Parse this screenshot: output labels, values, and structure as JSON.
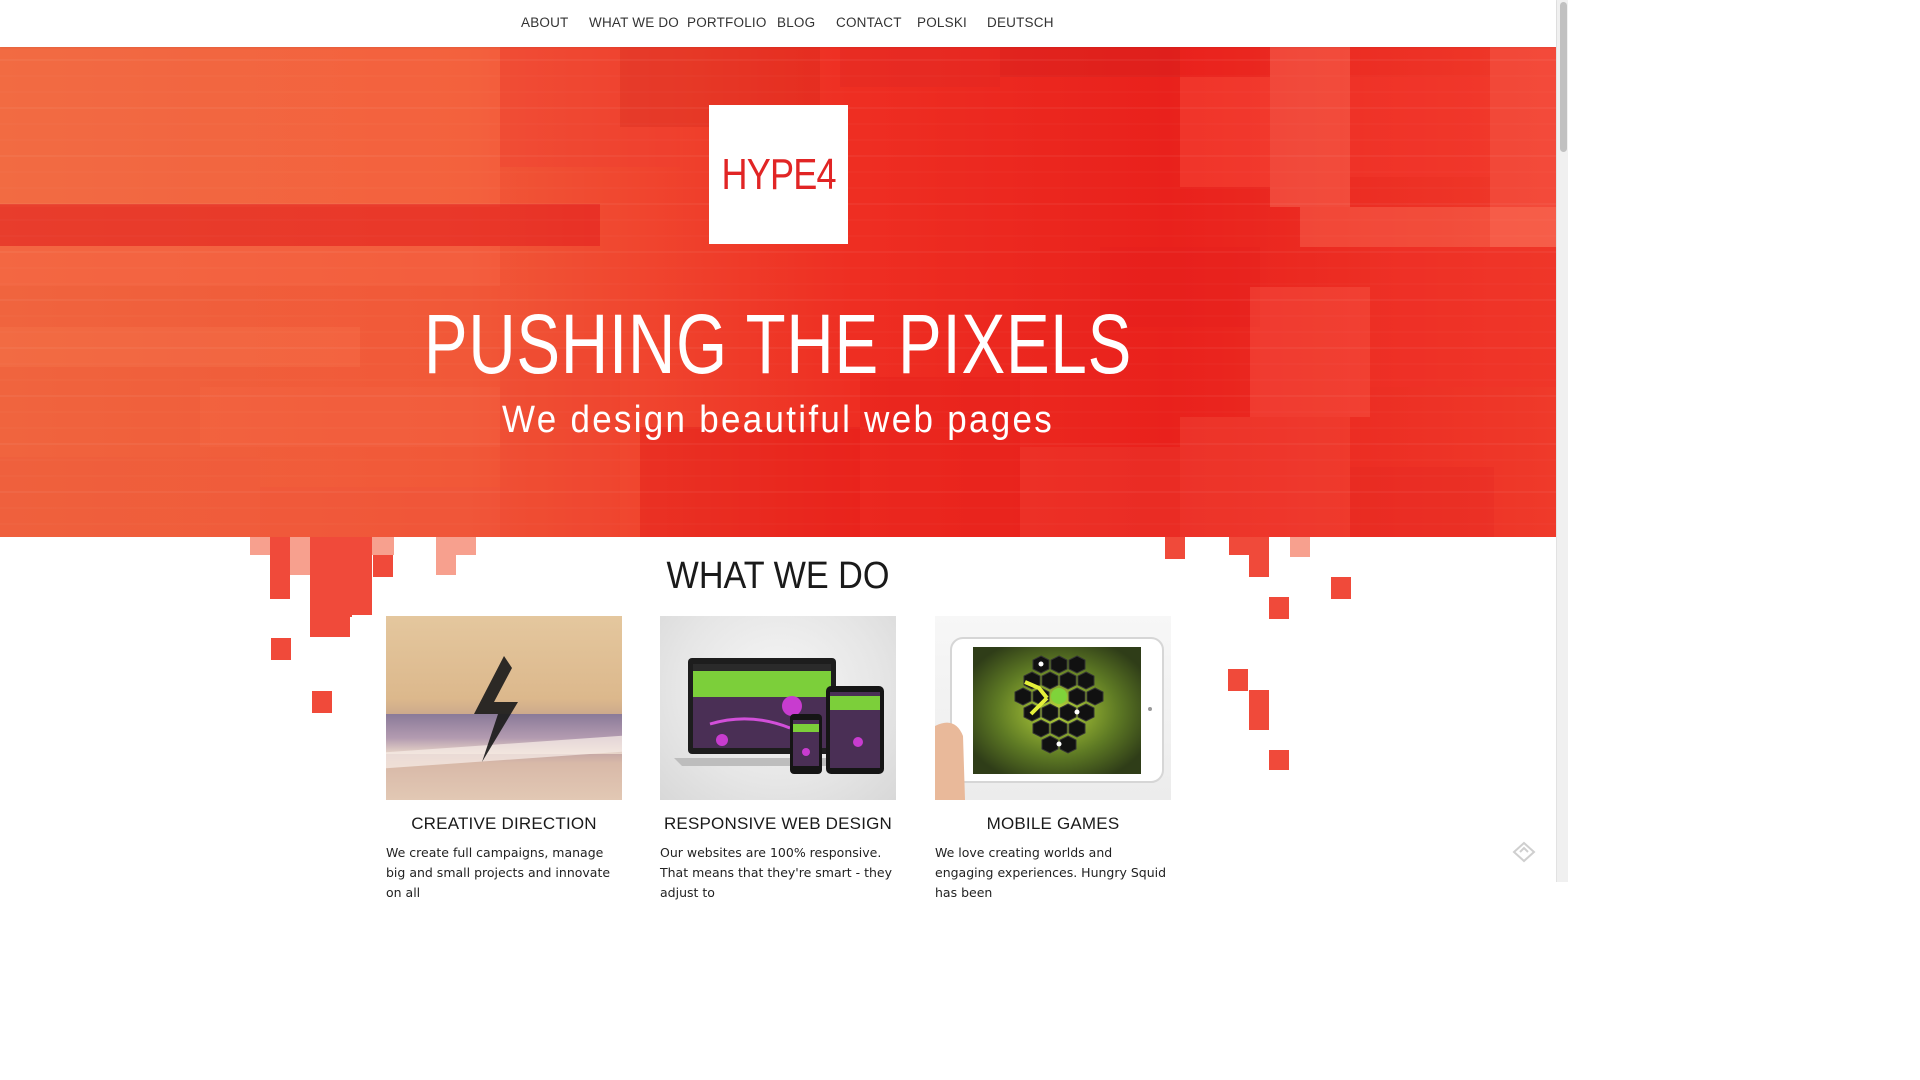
{
  "nav": {
    "items": [
      {
        "label": "ABOUT"
      },
      {
        "label": "WHAT WE DO"
      },
      {
        "label": "PORTFOLIO"
      },
      {
        "label": "BLOG"
      },
      {
        "label": "CONTACT"
      },
      {
        "label": "POLSKI"
      },
      {
        "label": "DEUTSCH"
      }
    ]
  },
  "hero": {
    "logo": "HYPE4",
    "title": "PUSHING THE PIXELS",
    "subtitle": "We design beautiful web pages"
  },
  "services": {
    "title": "WHAT WE DO",
    "cards": [
      {
        "title": "CREATIVE DIRECTION",
        "text": "We create full campaigns, manage big and small projects and innovate on all",
        "image_icon": "lightning-bolt-icon"
      },
      {
        "title": "RESPONSIVE WEB DESIGN",
        "text": "Our websites are 100% responsive. That means that they're smart - they adjust to",
        "image_icon": "devices-mockup"
      },
      {
        "title": "MOBILE GAMES",
        "text": "We love creating worlds and engaging experiences. Hungry Squid has been",
        "image_icon": "tablet-game"
      }
    ]
  },
  "colors": {
    "brand_red": "#e12525",
    "hero_red": "#ee2e22",
    "hero_orange": "#f0643e",
    "pixel_red": "#f04a3a",
    "pixel_pink": "#f7a08e"
  }
}
